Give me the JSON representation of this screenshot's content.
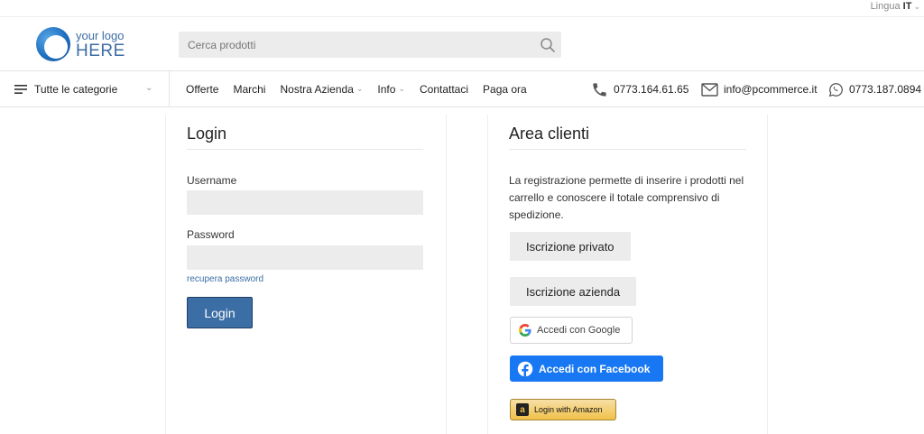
{
  "lang_bar": {
    "label": "Lingua",
    "code": "IT"
  },
  "logo": {
    "line1": "your logo",
    "line2": "HERE"
  },
  "search": {
    "placeholder": "Cerca prodotti"
  },
  "nav": {
    "categories_label": "Tutte le categorie",
    "menu": [
      "Offerte",
      "Marchi",
      "Nostra Azienda",
      "Info",
      "Contattaci",
      "Paga ora"
    ],
    "phone": "0773.164.61.65",
    "email": "info@pcommerce.it",
    "whatsapp": "0773.187.0894"
  },
  "login": {
    "title": "Login",
    "username_label": "Username",
    "password_label": "Password",
    "recover_label": "recupera password",
    "submit_label": "Login"
  },
  "area": {
    "title": "Area clienti",
    "description": "La registrazione permette di inserire i prodotti nel carrello e conoscere il totale comprensivo di spedizione.",
    "private_label": "Iscrizione privato",
    "company_label": "Iscrizione azienda",
    "google_label": "Accedi con Google",
    "facebook_label": "Accedi con Facebook",
    "amazon_label": "Login with Amazon"
  },
  "colors": {
    "accent": "#3a6ea5",
    "facebook": "#1877f2",
    "amazon": "#f0c14b"
  }
}
